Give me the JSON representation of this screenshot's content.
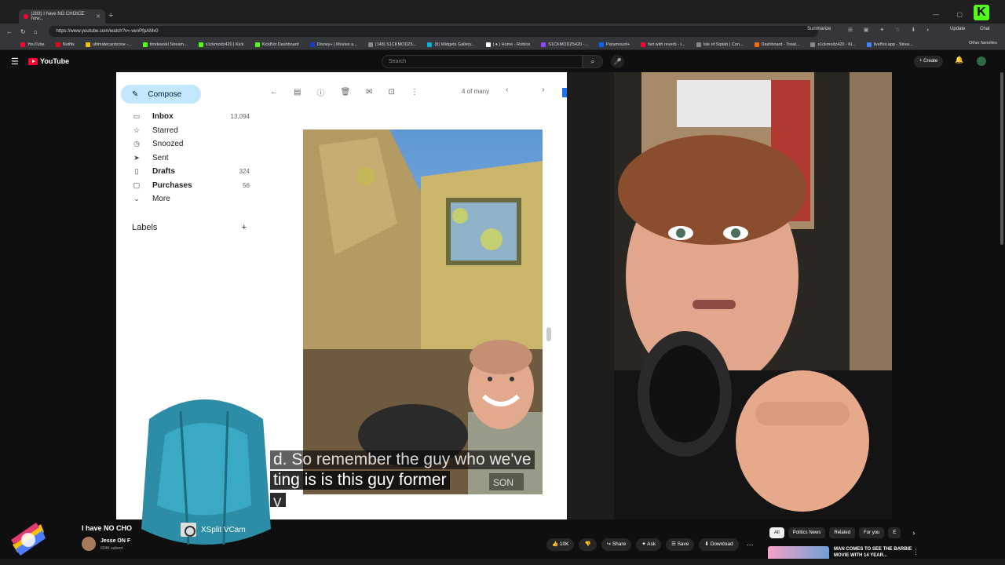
{
  "browser": {
    "tab_title": "(283) I have NO CHOICE now...",
    "url": "https://www.youtube.com/watch?v=-venPfpAMx0",
    "summarize_label": "Summarize",
    "update_label": "Update",
    "chat_label": "Chat",
    "other_favorites": "Other favorites",
    "bookmarks": [
      {
        "label": "YouTube",
        "color": "#ff0033"
      },
      {
        "label": "Netflix",
        "color": "#e50914"
      },
      {
        "label": "ultimatecardzone -...",
        "color": "#f4c20d"
      },
      {
        "label": "timdewski Stream...",
        "color": "#53fc18"
      },
      {
        "label": "s1ckmodz420 | Kick",
        "color": "#53fc18"
      },
      {
        "label": "KickBot Dashboard",
        "color": "#53fc18"
      },
      {
        "label": "Disney+ | Movies a...",
        "color": "#113ccf"
      },
      {
        "label": "(148) S1CKMODZ5...",
        "color": "#888888"
      },
      {
        "label": "(8) Widgets Gallery...",
        "color": "#00b4d8"
      },
      {
        "label": "( ♦ ) Home - Roblox",
        "color": "#ffffff"
      },
      {
        "label": "S1CKMODZ5420 -...",
        "color": "#9146ff"
      },
      {
        "label": "Paramount+",
        "color": "#0064ff"
      },
      {
        "label": "fart with reverb - I...",
        "color": "#ff0033"
      },
      {
        "label": "Isle of Siptah | Con...",
        "color": "#888888"
      },
      {
        "label": "Dashboard - Treat...",
        "color": "#ff6b00"
      },
      {
        "label": "s1ckmodz420 - Ki...",
        "color": "#888888"
      },
      {
        "label": "liveBot.app - Strea...",
        "color": "#3a86ff"
      }
    ]
  },
  "youtube": {
    "logo": "YouTube",
    "search_placeholder": "Search",
    "create_label": "Create",
    "video_title": "I have NO CHO",
    "channel_name": "Jesse ON F",
    "channel_subs": "604K subscri",
    "actions": {
      "likes": "10K",
      "share": "Share",
      "ask": "Ask",
      "save": "Save",
      "download": "Download"
    },
    "chips": [
      "All",
      "Politics News",
      "Related",
      "For you",
      "E"
    ],
    "recommendation_title": "MAN COMES TO SEE THE BARBIE MOVIE WITH 14 YEAR..."
  },
  "gmail": {
    "compose": "Compose",
    "nav": [
      {
        "label": "Inbox",
        "count": "13,094",
        "icon": "inbox-icon",
        "bold": true
      },
      {
        "label": "Starred",
        "count": "",
        "icon": "star-icon",
        "bold": false
      },
      {
        "label": "Snoozed",
        "count": "",
        "icon": "clock-icon",
        "bold": false
      },
      {
        "label": "Sent",
        "count": "",
        "icon": "send-icon",
        "bold": false
      },
      {
        "label": "Drafts",
        "count": "324",
        "icon": "draft-icon",
        "bold": true
      },
      {
        "label": "Purchases",
        "count": "56",
        "icon": "bag-icon",
        "bold": true
      },
      {
        "label": "More",
        "count": "",
        "icon": "chevron-down-icon",
        "bold": false
      }
    ],
    "labels_heading": "Labels",
    "pager": "4 of many"
  },
  "captions": {
    "line1": "d. So remember the guy who we've",
    "line2": "ting is is this guy former",
    "line3": "y"
  },
  "overlay": {
    "xsplit_label": "XSplit VCam",
    "patch_text": "SON"
  }
}
